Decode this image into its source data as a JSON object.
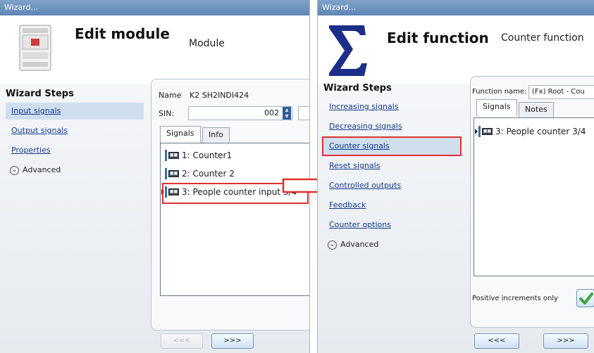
{
  "left": {
    "title_bar": "Wizard...",
    "header_title": "Edit module",
    "header_subtitle": "Module",
    "steps_heading": "Wizard Steps",
    "steps": [
      {
        "label": "Input signals",
        "selected": true
      },
      {
        "label": "Output signals",
        "selected": false
      },
      {
        "label": "Properties",
        "selected": false
      }
    ],
    "advanced": "Advanced",
    "name_label": "Name",
    "name_value": "K2 SH2INDI424",
    "sin_label": "SIN:",
    "sin_value": "002",
    "tabs": [
      {
        "label": "Signals",
        "active": true
      },
      {
        "label": "Info",
        "active": false
      }
    ],
    "signals": [
      {
        "label": "1: Counter1"
      },
      {
        "label": "2: Counter 2"
      },
      {
        "label": "3: People counter input 3/4",
        "highlighted": true
      }
    ],
    "prev_button": "<<<",
    "next_button": ">>>"
  },
  "right": {
    "title_bar": "Wizard...",
    "header_title": "Edit function",
    "header_subtitle": "Counter function",
    "steps_heading": "Wizard Steps",
    "steps": [
      {
        "label": "Increasing signals",
        "selected": false
      },
      {
        "label": "Decreasing signals",
        "selected": false
      },
      {
        "label": "Counter signals",
        "selected": true
      },
      {
        "label": "Reset signals",
        "selected": false
      },
      {
        "label": "Controlled outputs",
        "selected": false
      },
      {
        "label": "Feedback",
        "selected": false
      },
      {
        "label": "Counter options",
        "selected": false
      }
    ],
    "advanced": "Advanced",
    "function_name_label": "Function name:",
    "function_name_value": "(Fx) Root - Cou",
    "tabs": [
      {
        "label": "Signals",
        "active": true
      },
      {
        "label": "Notes",
        "active": false
      }
    ],
    "signals": [
      {
        "label": "3: People counter 3/4",
        "highlighted": true
      }
    ],
    "positive_label": "Positive increments only",
    "positive_checked": true,
    "prev_button": "<<<",
    "next_button": ">>>"
  },
  "colors": {
    "highlight": "#e03030",
    "arrow": "#e03030",
    "link": "#123a8a",
    "selected_step": "#cfdfee",
    "sigma": "#1c2e8a"
  },
  "icons": [
    "module-device-icon",
    "sigma-icon",
    "signal-icon",
    "checkmark-icon",
    "expand-circle-icon",
    "arrow-right-icon"
  ]
}
